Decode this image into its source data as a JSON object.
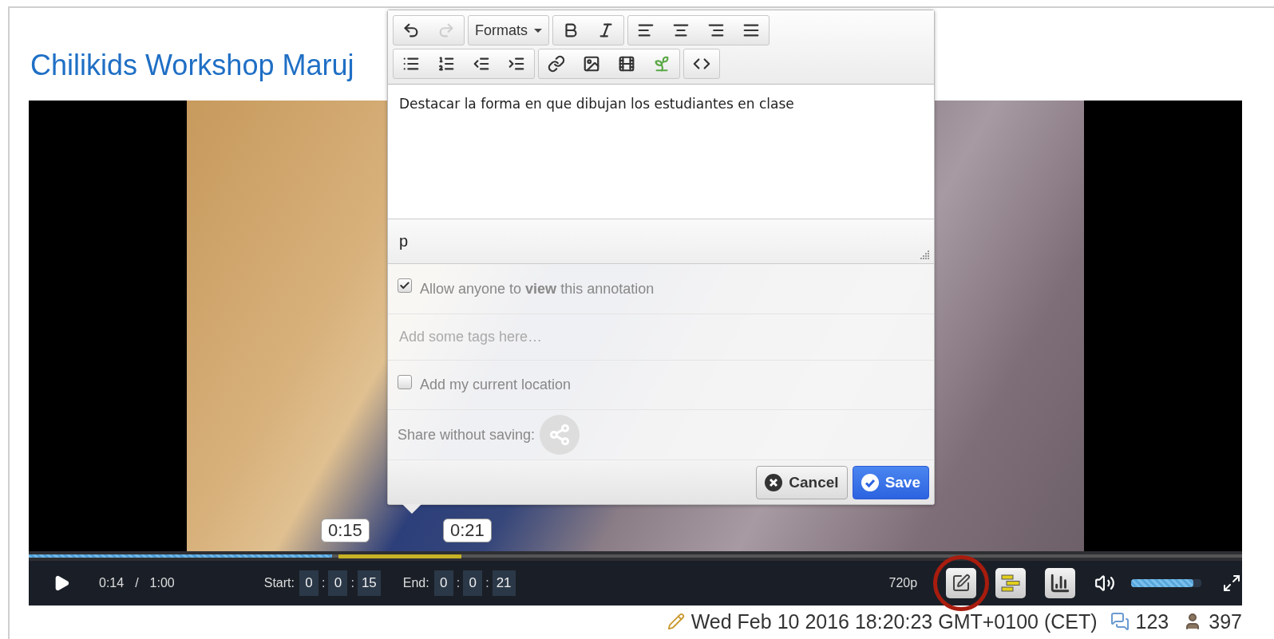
{
  "page_title": "Chilikids Workshop Maruj",
  "editor": {
    "toolbar": [
      [
        [
          {
            "kind": "undo",
            "disabled": false
          },
          {
            "kind": "redo",
            "disabled": true
          }
        ],
        [
          {
            "kind": "formats",
            "label": "Formats",
            "disabled": false
          }
        ],
        [
          {
            "kind": "bold",
            "disabled": false
          },
          {
            "kind": "italic",
            "disabled": false
          }
        ],
        [
          {
            "kind": "align-left",
            "disabled": false
          },
          {
            "kind": "align-center",
            "disabled": false
          },
          {
            "kind": "align-right",
            "disabled": false
          },
          {
            "kind": "align-justify",
            "disabled": false
          }
        ]
      ],
      [
        [
          {
            "kind": "bullet-list",
            "disabled": false
          },
          {
            "kind": "numbered-list",
            "disabled": false
          },
          {
            "kind": "outdent",
            "disabled": false
          },
          {
            "kind": "indent",
            "disabled": false
          }
        ],
        [
          {
            "kind": "link",
            "disabled": false
          },
          {
            "kind": "image",
            "disabled": false
          },
          {
            "kind": "media",
            "disabled": false
          },
          {
            "kind": "plant",
            "disabled": false
          }
        ],
        [
          {
            "kind": "code",
            "disabled": false
          }
        ]
      ]
    ],
    "content": "Destacar la forma en que dibujan los estudiantes en clase",
    "path": "p",
    "permission": {
      "label": "Allow anyone to **view** this annotation",
      "checked": true
    },
    "tags": {
      "placeholder": "Add some tags here…"
    },
    "location": {
      "label": "Add my current location",
      "checked": false
    },
    "share": {
      "label": "Share without saving:"
    },
    "buttons": [
      {
        "kind": "cancel",
        "label": "Cancel"
      },
      {
        "kind": "save",
        "label": "Save"
      }
    ]
  },
  "player": {
    "markers": [
      "0:15",
      "0:21"
    ],
    "progress": {
      "level": 0.25
    },
    "current_time": "0:14",
    "time_separator": "/",
    "duration": "1:00",
    "start": {
      "label": "Start:",
      "parts": [
        {
          "kind": "field",
          "text": "0"
        },
        {
          "kind": "sep",
          "text": ":"
        },
        {
          "kind": "field",
          "text": "0"
        },
        {
          "kind": "sep",
          "text": ":"
        },
        {
          "kind": "field",
          "text": "15"
        }
      ]
    },
    "end": {
      "label": "End:",
      "parts": [
        {
          "kind": "field",
          "text": "0"
        },
        {
          "kind": "sep",
          "text": ":"
        },
        {
          "kind": "field",
          "text": "0"
        },
        {
          "kind": "sep",
          "text": ":"
        },
        {
          "kind": "field",
          "text": "21"
        }
      ]
    },
    "quality": "720p",
    "tools": [
      {
        "kind": "edit",
        "highlighted": true
      },
      {
        "kind": "list",
        "highlighted": false
      },
      {
        "kind": "chart",
        "highlighted": false
      }
    ],
    "volume": {
      "level": 0.88
    }
  },
  "footer": {
    "date": "Wed Feb 10 2016 18:20:23 GMT+0100 (CET)",
    "comments": "123",
    "views": "397"
  }
}
